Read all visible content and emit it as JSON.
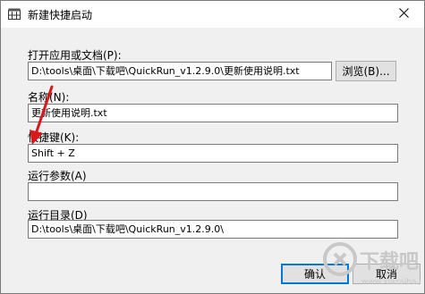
{
  "window": {
    "title": "新建快捷启动"
  },
  "target": {
    "label": "打开应用或文档(P):",
    "value": "D:\\tools\\桌面\\下载吧\\QuickRun_v1.2.9.0\\更新使用说明.txt",
    "browse_label": "浏览(B)..."
  },
  "name": {
    "label": "名称(N):",
    "value": "更新使用说明.txt"
  },
  "hotkey": {
    "label": "快捷键(K):",
    "value": "Shift + Z"
  },
  "params": {
    "label": "运行参数(A)",
    "value": ""
  },
  "workdir": {
    "label": "运行目录(D)",
    "value": "D:\\tools\\桌面\\下载吧\\QuickRun_v1.2.9.0\\"
  },
  "buttons": {
    "ok": "确认",
    "cancel": "取消"
  },
  "watermark": {
    "text": "下载吧",
    "url": "www.xiazaiba.com"
  },
  "colors": {
    "annotation_arrow": "#d7191c",
    "focus_border": "#0078d7"
  },
  "icons": {
    "app": "app-window-icon",
    "close": "close-icon"
  }
}
